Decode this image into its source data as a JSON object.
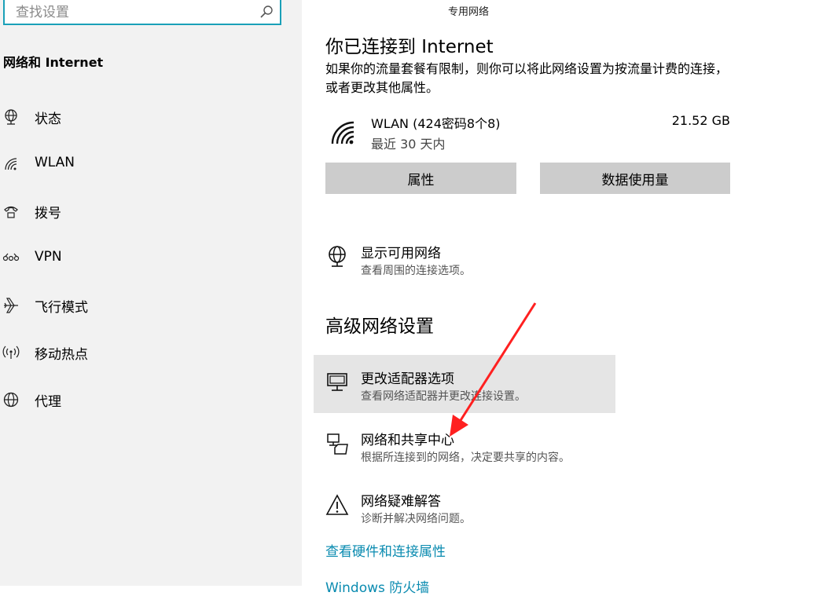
{
  "sidebar": {
    "search": {
      "placeholder": "查找设置"
    },
    "section_title": "网络和 Internet",
    "items": [
      {
        "label": "状态",
        "icon": "globe-status-icon"
      },
      {
        "label": "WLAN",
        "icon": "wifi-icon"
      },
      {
        "label": "拨号",
        "icon": "dialup-icon"
      },
      {
        "label": "VPN",
        "icon": "vpn-icon"
      },
      {
        "label": "飞行模式",
        "icon": "airplane-icon"
      },
      {
        "label": "移动热点",
        "icon": "hotspot-icon"
      },
      {
        "label": "代理",
        "icon": "globe-icon"
      }
    ]
  },
  "main": {
    "network_type": "专用网络",
    "status_title": "你已连接到 Internet",
    "status_desc": "如果你的流量套餐有限制，则你可以将此网络设置为按流量计费的连接，或者更改其他属性。",
    "wlan": {
      "name": "WLAN (424密码8个8)",
      "sub": "最近 30 天内",
      "usage": "21.52 GB"
    },
    "buttons": {
      "properties": "属性",
      "data_usage": "数据使用量"
    },
    "show_networks": {
      "title": "显示可用网络",
      "desc": "查看周围的连接选项。"
    },
    "advanced_heading": "高级网络设置",
    "advanced_items": [
      {
        "title": "更改适配器选项",
        "desc": "查看网络适配器并更改连接设置。"
      },
      {
        "title": "网络和共享中心",
        "desc": "根据所连接到的网络，决定要共享的内容。"
      },
      {
        "title": "网络疑难解答",
        "desc": "诊断并解决网络问题。"
      }
    ],
    "links": {
      "hardware": "查看硬件和连接属性",
      "firewall": "Windows 防火墙"
    }
  },
  "colors": {
    "accent": "#0a8bb0",
    "search_border": "#1aa0b8",
    "annotation_arrow": "#ff2020"
  }
}
